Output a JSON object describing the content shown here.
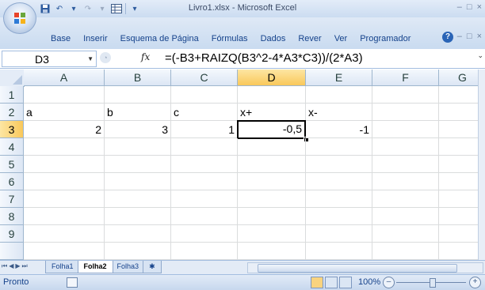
{
  "window": {
    "title": "Livro1.xlsx - Microsoft Excel",
    "minimize": "–",
    "maximize": "□",
    "close": "×"
  },
  "ribbon": {
    "tabs": [
      "Base",
      "Inserir",
      "Esquema de Página",
      "Fórmulas",
      "Dados",
      "Rever",
      "Ver",
      "Programador"
    ],
    "help": "?"
  },
  "formula_bar": {
    "name_box": "D3",
    "fx_label": "fx",
    "formula": "=(-B3+RAIZQ(B3^2-4*A3*C3))/(2*A3)"
  },
  "grid": {
    "columns": [
      "A",
      "B",
      "C",
      "D",
      "E",
      "F",
      "G"
    ],
    "rows": [
      "1",
      "2",
      "3",
      "4",
      "5",
      "6",
      "7",
      "8",
      "9"
    ],
    "active_cell": "D3",
    "cells": {
      "A2": "a",
      "B2": "b",
      "C2": "c",
      "D2": "x+",
      "E2": "x-",
      "A3": "2",
      "B3": "3",
      "C3": "1",
      "D3": "-0,5",
      "E3": "-1"
    }
  },
  "sheets": {
    "tabs": [
      "Folha1",
      "Folha2",
      "Folha3"
    ],
    "active": "Folha2"
  },
  "status": {
    "text": "Pronto",
    "zoom": "100%",
    "zoom_minus": "–",
    "zoom_plus": "+"
  },
  "colors": {
    "accent": "#15428b",
    "active_header": "#f9c85a",
    "grid_line": "#dadcdd"
  }
}
